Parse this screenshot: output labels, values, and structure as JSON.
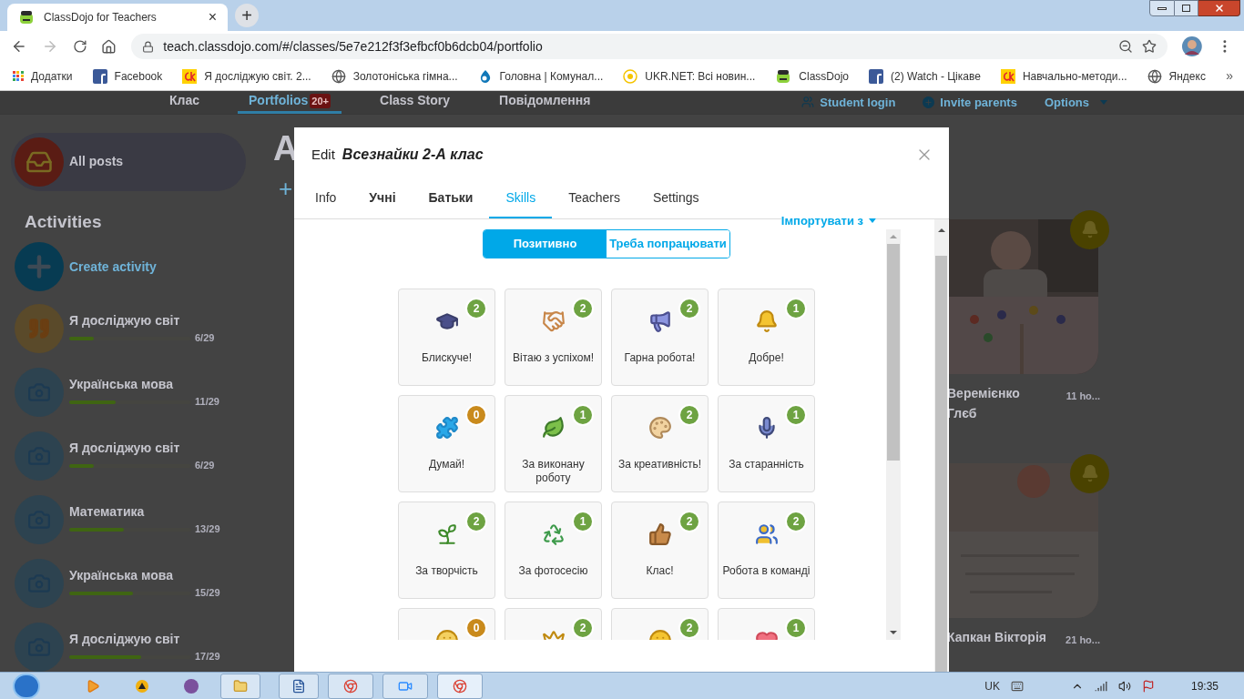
{
  "browser": {
    "tab": {
      "title": "ClassDojo for Teachers",
      "close": "×"
    },
    "new_tab": "+",
    "url": "teach.classdojo.com/#/classes/5e7e212f3f3efbcf0b6dcb04/portfolio",
    "bookmarks": [
      {
        "label": "Додатки",
        "kind": "apps"
      },
      {
        "label": "Facebook",
        "kind": "facebook"
      },
      {
        "label": "Я досліджую світ. 2...",
        "kind": "ck"
      },
      {
        "label": "Золотоніська гімна...",
        "kind": "globe"
      },
      {
        "label": "Головна | Комунал...",
        "kind": "drop"
      },
      {
        "label": "UKR.NET: Всі новин...",
        "kind": "ukr"
      },
      {
        "label": "ClassDojo",
        "kind": "dojo"
      },
      {
        "label": "(2) Watch - Цікаве",
        "kind": "facebook"
      },
      {
        "label": "Навчально-методи...",
        "kind": "ck"
      },
      {
        "label": "Яндекс",
        "kind": "globe"
      }
    ],
    "more": "»"
  },
  "nav": {
    "items": [
      {
        "label": "Клас",
        "selected": false
      },
      {
        "label": "Portfolios",
        "badge": "20+",
        "selected": true
      },
      {
        "label": "Class Story",
        "selected": false
      },
      {
        "label": "Повідомлення",
        "selected": false
      }
    ],
    "actions": [
      {
        "label": "Student login",
        "kind": "students"
      },
      {
        "label": "Invite parents",
        "kind": "plus"
      },
      {
        "label": "Options",
        "kind": "dropdown"
      }
    ]
  },
  "sidebar": {
    "all_posts": "All posts",
    "heading": "Activities",
    "create": "Create activity",
    "activities": [
      {
        "name": "Я досліджую світ",
        "kind": "quote",
        "level": 0.2,
        "count": "6/29"
      },
      {
        "name": "Українська мова",
        "level": 0.38,
        "count": "11/29"
      },
      {
        "name": "Я досліджую світ",
        "level": 0.2,
        "count": "6/29"
      },
      {
        "name": "Математика",
        "level": 0.45,
        "count": "13/29"
      },
      {
        "name": "Українська мова",
        "level": 0.52,
        "count": "15/29"
      },
      {
        "name": "Я досліджую світ",
        "level": 0.59,
        "count": "17/29"
      }
    ]
  },
  "main": {
    "heading": "A",
    "add": "+"
  },
  "feed": [
    {
      "name": "Веремієнко Глєб",
      "time": "11 ho..."
    },
    {
      "name": "Капкан Вікторія",
      "time": "21 ho..."
    }
  ],
  "modal": {
    "edit": "Edit",
    "class_name": "Всезнайки 2-А клас",
    "tabs": [
      {
        "label": "Info",
        "bold": false,
        "selected": false
      },
      {
        "label": "Учні",
        "bold": true,
        "selected": false
      },
      {
        "label": "Батьки",
        "bold": true,
        "selected": false
      },
      {
        "label": "Skills",
        "bold": false,
        "selected": true
      },
      {
        "label": "Teachers",
        "bold": false,
        "selected": false
      },
      {
        "label": "Settings",
        "bold": false,
        "selected": false
      }
    ],
    "import": "Імпортувати з",
    "segments": [
      {
        "label": "Позитивно",
        "selected": true
      },
      {
        "label": "Треба попрацювати",
        "selected": false
      }
    ],
    "skills": [
      {
        "name": "Блискуче!",
        "count": "2",
        "color": "#6ea342"
      },
      {
        "name": "Вітаю з успіхом!",
        "count": "2",
        "color": "#6ea342"
      },
      {
        "name": "Гарна робота!",
        "count": "2",
        "color": "#6ea342"
      },
      {
        "name": "Добре!",
        "count": "1",
        "color": "#6ea342"
      },
      {
        "name": "Думай!",
        "count": "0",
        "color": "#c98a1c"
      },
      {
        "name": "За виконану роботу",
        "count": "1",
        "color": "#6ea342"
      },
      {
        "name": "За креативність!",
        "count": "2",
        "color": "#6ea342"
      },
      {
        "name": "За старанність",
        "count": "1",
        "color": "#6ea342"
      },
      {
        "name": "За творчість",
        "count": "2",
        "color": "#6ea342"
      },
      {
        "name": "За фотосесію",
        "count": "1",
        "color": "#6ea342"
      },
      {
        "name": "Клас!",
        "count": "2",
        "color": "#6ea342"
      },
      {
        "name": "Робота в команді",
        "count": "2",
        "color": "#6ea342"
      },
      {
        "count": "0",
        "color": "#c98a1c"
      },
      {
        "count": "2",
        "color": "#6ea342"
      },
      {
        "count": "2",
        "color": "#6ea342"
      },
      {
        "count": "1",
        "color": "#6ea342"
      }
    ]
  },
  "taskbar": {
    "language": "UK",
    "time": "19:35"
  }
}
